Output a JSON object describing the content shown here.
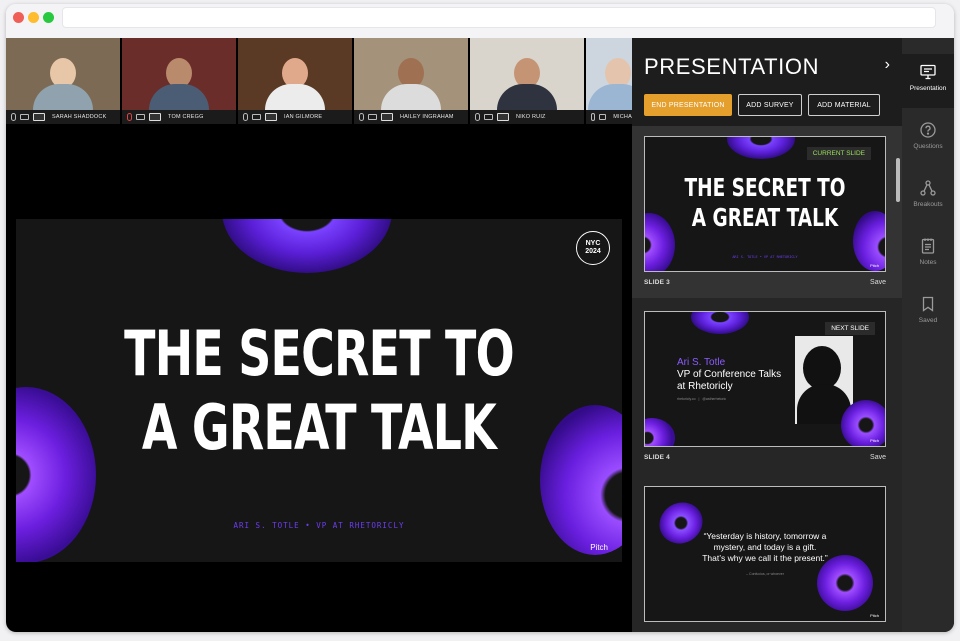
{
  "window": {
    "dots": [
      "#ef5f57",
      "#febc2e",
      "#28c840"
    ]
  },
  "participants": [
    {
      "name": "SARAH SHADDOCK",
      "bg": "#7d6a55",
      "skin": "#e8c7a8",
      "shirt": "#8fa2ad"
    },
    {
      "name": "TOM CREGG",
      "bg": "#6b2d2a",
      "skin": "#b98a6c",
      "shirt": "#4b5d74"
    },
    {
      "name": "IAN GILMORE",
      "bg": "#5a3a24",
      "skin": "#e1a98c",
      "shirt": "#ececec"
    },
    {
      "name": "HAILEY INGRAHAM",
      "bg": "#a5927a",
      "skin": "#a07053",
      "shirt": "#dcdcdc"
    },
    {
      "name": "NIKO RUIZ",
      "bg": "#d9d4cc",
      "skin": "#c59475",
      "shirt": "#2f3340"
    },
    {
      "name": "MICHA",
      "bg": "#cdd6de",
      "skin": "#e5c4ad",
      "shirt": "#9ab6d3"
    }
  ],
  "main_slide": {
    "title_line1": "THE SECRET TO",
    "title_line2": "A GREAT TALK",
    "subtitle": "ARI S. TOTLE • VP AT RHETORICLY",
    "badge_line1": "NYC",
    "badge_line2": "2024",
    "brand": "Pitch"
  },
  "panel": {
    "title": "PRESENTATION",
    "expand_icon": "chevron-right-icon",
    "buttons": {
      "end": "END PRESENTATION",
      "survey": "ADD SURVEY",
      "material": "ADD MATERIAL"
    },
    "accent": "#e59f2d"
  },
  "queue": [
    {
      "label": "SLIDE 3",
      "save": "Save",
      "badge": "CURRENT SLIDE",
      "badge_color": "#9be15d",
      "title_line1": "THE SECRET TO",
      "title_line2": "A GREAT TALK",
      "subtitle": "ARI S. TOTLE • VP AT RHETORICLY",
      "brand": "Pitch"
    },
    {
      "label": "SLIDE 4",
      "save": "Save",
      "badge": "NEXT SLIDE",
      "name": "Ari S. Totle",
      "role_line1": "VP of Conference Talks",
      "role_line2": "at Rhetoricly",
      "links": "rhetoricly.co   |   @astherhetoric",
      "brand": "Pitch"
    },
    {
      "quote_line1": "“Yesterday is history, tomorrow a",
      "quote_line2": "mystery, and today is a gift.",
      "quote_line3": "That’s why we call it the present.”",
      "attribution": "– Confucius, or whoever",
      "brand": "Pitch"
    }
  ],
  "rail": [
    {
      "label": "Presentation",
      "icon": "presentation-icon",
      "active": true
    },
    {
      "label": "Questions",
      "icon": "question-icon",
      "active": false
    },
    {
      "label": "Breakouts",
      "icon": "breakouts-icon",
      "active": false
    },
    {
      "label": "Notes",
      "icon": "notes-icon",
      "active": false
    },
    {
      "label": "Saved",
      "icon": "bookmark-icon",
      "active": false
    }
  ]
}
